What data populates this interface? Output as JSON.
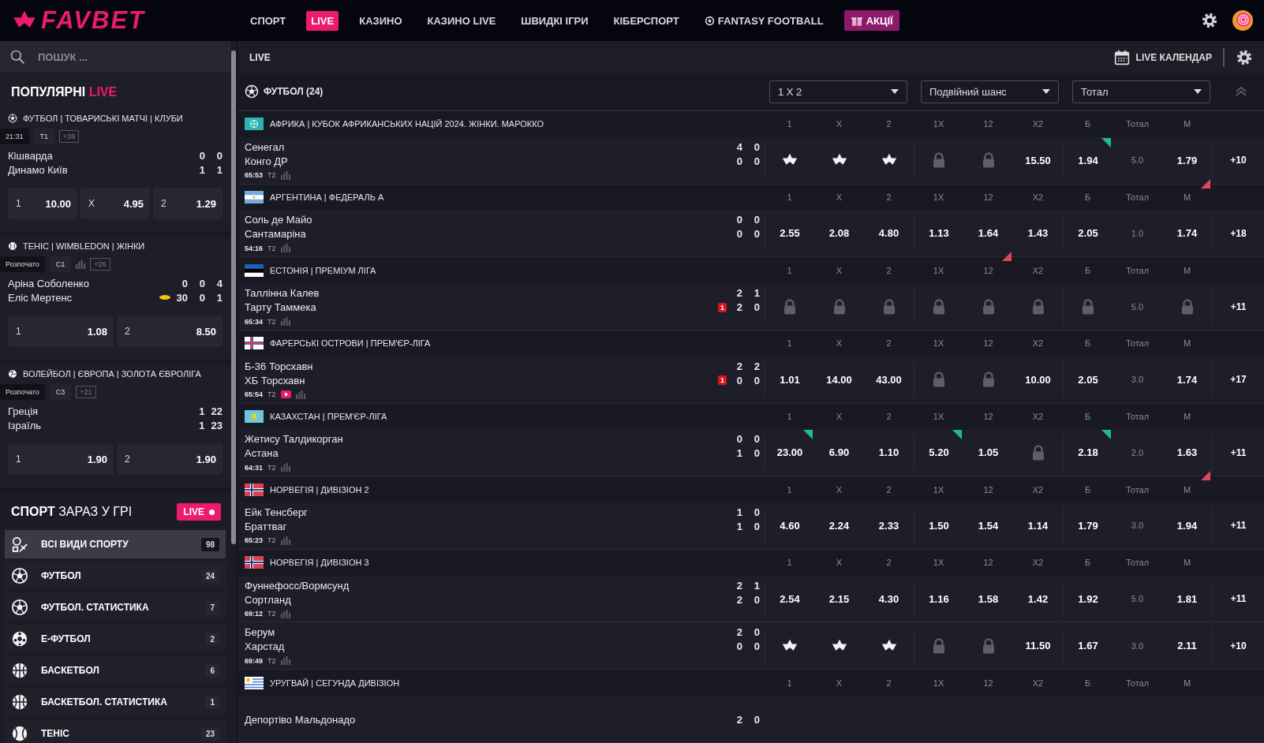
{
  "brand": "FAVBET",
  "nav": [
    {
      "label": "СПОРТ",
      "selected": false,
      "kind": "plain"
    },
    {
      "label": "LIVE",
      "selected": true,
      "kind": "plain"
    },
    {
      "label": "КАЗИНО",
      "selected": false,
      "kind": "plain"
    },
    {
      "label": "КАЗИНО LIVE",
      "selected": false,
      "kind": "plain"
    },
    {
      "label": "ШВИДКІ ІГРИ",
      "selected": false,
      "kind": "plain"
    },
    {
      "label": "КІБЕРСПОРТ",
      "selected": false,
      "kind": "plain"
    },
    {
      "label": "FANTASY FOOTBALL",
      "selected": false,
      "kind": "icon"
    },
    {
      "label": "АКЦІЇ",
      "selected": false,
      "kind": "promo"
    }
  ],
  "sidebar": {
    "search": {
      "placeholder": "ПОШУК ..."
    },
    "popular": {
      "title": "ПОПУЛЯРНІ",
      "accent": "LIVE",
      "events": [
        {
          "kind": "football",
          "title": "ФУТБОЛ | ТОВАРИСЬКІ МАТЧІ | КЛУБИ",
          "status": "21:31",
          "period": "Т1",
          "stats": false,
          "more": "+39",
          "teams": [
            {
              "name": "Кішварда",
              "scores": [
                "0",
                "0"
              ]
            },
            {
              "name": "Динамо Київ",
              "scores": [
                "1",
                "1"
              ]
            }
          ],
          "odds": [
            {
              "label": "1",
              "value": "10.00"
            },
            {
              "label": "X",
              "value": "4.95"
            },
            {
              "label": "2",
              "value": "1.29"
            }
          ]
        },
        {
          "kind": "tennis",
          "title": "ТЕНІС | WIMBLEDON | ЖІНКИ",
          "status": "Розпочато",
          "period": "С1",
          "stats": true,
          "more": "+26",
          "teams": [
            {
              "name": "Аріна Соболенко",
              "scores": [
                "0",
                "0",
                "4"
              ],
              "serving": false
            },
            {
              "name": "Еліс Мертенс",
              "scores": [
                "30",
                "0",
                "1"
              ],
              "serving": true
            }
          ],
          "odds": [
            {
              "label": "1",
              "value": "1.08"
            },
            {
              "label": "2",
              "value": "8.50"
            }
          ]
        },
        {
          "kind": "volleyball",
          "title": "ВОЛЕЙБОЛ | ЄВРОПА | ЗОЛОТА ЄВРОЛІГА",
          "status": "Розпочато",
          "period": "С3",
          "stats": false,
          "more": "+21",
          "teams": [
            {
              "name": "Греція",
              "scores": [
                "1",
                "22"
              ]
            },
            {
              "name": "Ізраїль",
              "scores": [
                "1",
                "23"
              ]
            }
          ],
          "odds": [
            {
              "label": "1",
              "value": "1.90"
            },
            {
              "label": "2",
              "value": "1.90"
            }
          ]
        }
      ]
    },
    "sports": {
      "title": "**СПОРТ** ЗАРАЗ У ГРІ",
      "badge": "LIVE",
      "items": [
        {
          "kind": "all",
          "name": "ВСІ ВИДИ СПОРТУ",
          "count": "98",
          "selected": true
        },
        {
          "kind": "football",
          "name": "ФУТБОЛ",
          "count": "24",
          "selected": false
        },
        {
          "kind": "football-stats",
          "name": "ФУТБОЛ. СТАТИСТИКА",
          "count": "7",
          "selected": false
        },
        {
          "kind": "efootball",
          "name": "Е-ФУТБОЛ",
          "count": "2",
          "selected": false
        },
        {
          "kind": "basketball",
          "name": "БАСКЕТБОЛ",
          "count": "6",
          "selected": false
        },
        {
          "kind": "basketball-stats",
          "name": "БАСКЕТБОЛ. СТАТИСТИКА",
          "count": "1",
          "selected": false
        },
        {
          "kind": "tennis",
          "name": "ТЕНІС",
          "count": "23",
          "selected": false
        }
      ]
    }
  },
  "main": {
    "title": "LIVE",
    "calendar": "LIVE КАЛЕНДАР",
    "sport_title": "ФУТБОЛ (24)",
    "markets": [
      {
        "value": "1 X 2"
      },
      {
        "value": "Подвійний шанс"
      },
      {
        "value": "Тотал"
      }
    ],
    "leagues": [
      {
        "kind": "africa",
        "title": "АФРИКА | КУБОК АФРИКАНСЬКИХ НАЦІЙ 2024. ЖІНКИ. МАРОККО",
        "columns": [
          "1",
          "X",
          "2",
          "1X",
          "12",
          "X2",
          "Б",
          "Тотал",
          "М"
        ],
        "matches": [
          {
            "teams": [
              {
                "name": "Сенегал",
                "scores": [
                  "4",
                  "0"
                ]
              },
              {
                "name": "Конго ДР",
                "scores": [
                  "0",
                  "0"
                ]
              }
            ],
            "time": "65:53",
            "period": "Т2",
            "video": false,
            "more": "+10",
            "odds": [
              {
                "kind": "suspended",
                "up": false,
                "down": false
              },
              {
                "kind": "suspended",
                "up": false,
                "down": false
              },
              {
                "kind": "suspended",
                "up": false,
                "down": false
              },
              {
                "kind": "locked",
                "up": false,
                "down": false
              },
              {
                "kind": "locked",
                "up": false,
                "down": false
              },
              {
                "kind": "odd",
                "value": "15.50",
                "up": false,
                "down": false
              },
              {
                "kind": "odd",
                "value": "1.94",
                "up": true,
                "down": false
              },
              {
                "kind": "total",
                "value": "5.0",
                "up": false,
                "down": false
              },
              {
                "kind": "odd",
                "value": "1.79",
                "up": false,
                "down": true
              }
            ]
          }
        ]
      },
      {
        "kind": "argentina",
        "title": "АРГЕНТИНА | ФЕДЕРАЛЬ А",
        "columns": [
          "1",
          "X",
          "2",
          "1X",
          "12",
          "X2",
          "Б",
          "Тотал",
          "М"
        ],
        "matches": [
          {
            "teams": [
              {
                "name": "Соль де Майо",
                "scores": [
                  "0",
                  "0"
                ]
              },
              {
                "name": "Сантамаріна",
                "scores": [
                  "0",
                  "0"
                ]
              }
            ],
            "time": "54:16",
            "period": "Т2",
            "video": false,
            "more": "+18",
            "odds": [
              {
                "kind": "odd",
                "value": "2.55",
                "up": false,
                "down": false
              },
              {
                "kind": "odd",
                "value": "2.08",
                "up": false,
                "down": false
              },
              {
                "kind": "odd",
                "value": "4.80",
                "up": false,
                "down": false
              },
              {
                "kind": "odd",
                "value": "1.13",
                "up": false,
                "down": false
              },
              {
                "kind": "odd",
                "value": "1.64",
                "up": false,
                "down": true
              },
              {
                "kind": "odd",
                "value": "1.43",
                "up": false,
                "down": false
              },
              {
                "kind": "odd",
                "value": "2.05",
                "up": false,
                "down": false
              },
              {
                "kind": "total",
                "value": "1.0",
                "up": false,
                "down": false
              },
              {
                "kind": "odd",
                "value": "1.74",
                "up": false,
                "down": false
              }
            ]
          }
        ]
      },
      {
        "kind": "estonia",
        "title": "ЕСТОНІЯ | ПРЕМІУМ ЛІГА",
        "columns": [
          "1",
          "X",
          "2",
          "1X",
          "12",
          "X2",
          "Б",
          "Тотал",
          "М"
        ],
        "matches": [
          {
            "teams": [
              {
                "name": "Таллінна Калев",
                "scores": [
                  "2",
                  "1"
                ]
              },
              {
                "name": "Тарту Таммека",
                "scores": [
                  "2",
                  "0"
                ],
                "red_card": "1"
              }
            ],
            "time": "65:34",
            "period": "Т2",
            "video": false,
            "more": "+11",
            "odds": [
              {
                "kind": "locked",
                "up": false,
                "down": false
              },
              {
                "kind": "locked",
                "up": false,
                "down": false
              },
              {
                "kind": "locked",
                "up": false,
                "down": false
              },
              {
                "kind": "locked",
                "up": false,
                "down": false
              },
              {
                "kind": "locked",
                "up": false,
                "down": false
              },
              {
                "kind": "locked",
                "up": false,
                "down": false
              },
              {
                "kind": "locked",
                "up": false,
                "down": false
              },
              {
                "kind": "total",
                "value": "5.0",
                "up": false,
                "down": false
              },
              {
                "kind": "locked",
                "up": false,
                "down": false
              }
            ]
          }
        ]
      },
      {
        "kind": "faroe",
        "title": "ФАРЕРСЬКІ ОСТРОВИ | ПРЕМ'ЄР-ЛІГА",
        "columns": [
          "1",
          "X",
          "2",
          "1X",
          "12",
          "X2",
          "Б",
          "Тотал",
          "М"
        ],
        "matches": [
          {
            "teams": [
              {
                "name": "Б-36 Торсхавн",
                "scores": [
                  "2",
                  "2"
                ]
              },
              {
                "name": "ХБ Торсхавн",
                "scores": [
                  "0",
                  "0"
                ],
                "red_card": "1"
              }
            ],
            "time": "65:54",
            "period": "Т2",
            "video": true,
            "more": "+17",
            "odds": [
              {
                "kind": "odd",
                "value": "1.01",
                "up": false,
                "down": false
              },
              {
                "kind": "odd",
                "value": "14.00",
                "up": false,
                "down": false
              },
              {
                "kind": "odd",
                "value": "43.00",
                "up": false,
                "down": false
              },
              {
                "kind": "locked",
                "up": false,
                "down": false
              },
              {
                "kind": "locked",
                "up": false,
                "down": false
              },
              {
                "kind": "odd",
                "value": "10.00",
                "up": false,
                "down": false
              },
              {
                "kind": "odd",
                "value": "2.05",
                "up": false,
                "down": false
              },
              {
                "kind": "total",
                "value": "3.0",
                "up": false,
                "down": false
              },
              {
                "kind": "odd",
                "value": "1.74",
                "up": false,
                "down": false
              }
            ]
          }
        ]
      },
      {
        "kind": "kazakhstan",
        "title": "КАЗАХСТАН | ПРЕМ'ЄР-ЛІГА",
        "columns": [
          "1",
          "X",
          "2",
          "1X",
          "12",
          "X2",
          "Б",
          "Тотал",
          "М"
        ],
        "matches": [
          {
            "teams": [
              {
                "name": "Жетису Талдикорган",
                "scores": [
                  "0",
                  "0"
                ]
              },
              {
                "name": "Астана",
                "scores": [
                  "1",
                  "0"
                ]
              }
            ],
            "time": "64:31",
            "period": "Т2",
            "video": false,
            "more": "+11",
            "odds": [
              {
                "kind": "odd",
                "value": "23.00",
                "up": true,
                "down": false
              },
              {
                "kind": "odd",
                "value": "6.90",
                "up": false,
                "down": false
              },
              {
                "kind": "odd",
                "value": "1.10",
                "up": false,
                "down": false
              },
              {
                "kind": "odd",
                "value": "5.20",
                "up": true,
                "down": false
              },
              {
                "kind": "odd",
                "value": "1.05",
                "up": false,
                "down": false
              },
              {
                "kind": "locked",
                "up": false,
                "down": false
              },
              {
                "kind": "odd",
                "value": "2.18",
                "up": true,
                "down": false
              },
              {
                "kind": "total",
                "value": "2.0",
                "up": false,
                "down": false
              },
              {
                "kind": "odd",
                "value": "1.63",
                "up": false,
                "down": true
              }
            ]
          }
        ]
      },
      {
        "kind": "norway",
        "title": "НОРВЕГІЯ | ДИВІЗІОН 2",
        "columns": [
          "1",
          "X",
          "2",
          "1X",
          "12",
          "X2",
          "Б",
          "Тотал",
          "М"
        ],
        "matches": [
          {
            "teams": [
              {
                "name": "Ейк Тенсберг",
                "scores": [
                  "1",
                  "0"
                ]
              },
              {
                "name": "Браттваг",
                "scores": [
                  "1",
                  "0"
                ]
              }
            ],
            "time": "65:23",
            "period": "Т2",
            "video": false,
            "more": "+11",
            "odds": [
              {
                "kind": "odd",
                "value": "4.60",
                "up": false,
                "down": false
              },
              {
                "kind": "odd",
                "value": "2.24",
                "up": false,
                "down": false
              },
              {
                "kind": "odd",
                "value": "2.33",
                "up": false,
                "down": false
              },
              {
                "kind": "odd",
                "value": "1.50",
                "up": false,
                "down": false
              },
              {
                "kind": "odd",
                "value": "1.54",
                "up": false,
                "down": false
              },
              {
                "kind": "odd",
                "value": "1.14",
                "up": false,
                "down": false
              },
              {
                "kind": "odd",
                "value": "1.79",
                "up": false,
                "down": false
              },
              {
                "kind": "total",
                "value": "3.0",
                "up": false,
                "down": false
              },
              {
                "kind": "odd",
                "value": "1.94",
                "up": false,
                "down": false
              }
            ]
          }
        ]
      },
      {
        "kind": "norway",
        "title": "НОРВЕГІЯ | ДИВІЗІОН 3",
        "columns": [
          "1",
          "X",
          "2",
          "1X",
          "12",
          "X2",
          "Б",
          "Тотал",
          "М"
        ],
        "matches": [
          {
            "teams": [
              {
                "name": "Фуннефосс/Вормсунд",
                "scores": [
                  "2",
                  "1"
                ]
              },
              {
                "name": "Сортланд",
                "scores": [
                  "2",
                  "0"
                ]
              }
            ],
            "time": "69:12",
            "period": "Т2",
            "video": false,
            "more": "+11",
            "odds": [
              {
                "kind": "odd",
                "value": "2.54",
                "up": false,
                "down": false
              },
              {
                "kind": "odd",
                "value": "2.15",
                "up": false,
                "down": false
              },
              {
                "kind": "odd",
                "value": "4.30",
                "up": false,
                "down": false
              },
              {
                "kind": "odd",
                "value": "1.16",
                "up": false,
                "down": false
              },
              {
                "kind": "odd",
                "value": "1.58",
                "up": false,
                "down": false
              },
              {
                "kind": "odd",
                "value": "1.42",
                "up": false,
                "down": false
              },
              {
                "kind": "odd",
                "value": "1.92",
                "up": false,
                "down": false
              },
              {
                "kind": "total",
                "value": "5.0",
                "up": false,
                "down": false
              },
              {
                "kind": "odd",
                "value": "1.81",
                "up": false,
                "down": false
              }
            ]
          },
          {
            "teams": [
              {
                "name": "Берум",
                "scores": [
                  "2",
                  "0"
                ]
              },
              {
                "name": "Харстад",
                "scores": [
                  "0",
                  "0"
                ]
              }
            ],
            "time": "69:49",
            "period": "Т2",
            "video": false,
            "more": "+10",
            "odds": [
              {
                "kind": "suspended",
                "up": false,
                "down": false
              },
              {
                "kind": "suspended",
                "up": false,
                "down": false
              },
              {
                "kind": "suspended",
                "up": false,
                "down": false
              },
              {
                "kind": "locked",
                "up": false,
                "down": false
              },
              {
                "kind": "locked",
                "up": false,
                "down": false
              },
              {
                "kind": "odd",
                "value": "11.50",
                "up": false,
                "down": false
              },
              {
                "kind": "odd",
                "value": "1.67",
                "up": false,
                "down": false
              },
              {
                "kind": "total",
                "value": "3.0",
                "up": false,
                "down": false
              },
              {
                "kind": "odd",
                "value": "2.11",
                "up": false,
                "down": false
              }
            ]
          }
        ]
      },
      {
        "kind": "uruguay",
        "title": "УРУГВАЙ | СЕГУНДА ДИВІЗІОН",
        "columns": [
          "1",
          "X",
          "2",
          "1X",
          "12",
          "X2",
          "Б",
          "Тотал",
          "М"
        ],
        "matches": [
          {
            "teams": [
              {
                "name": "Депортіво Мальдонадо",
                "scores": [
                  "2",
                  "0"
                ]
              }
            ]
          }
        ]
      }
    ]
  }
}
